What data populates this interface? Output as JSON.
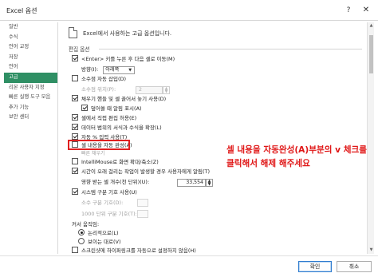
{
  "window": {
    "title": "Excel 옵션",
    "help_icon": "?",
    "close_icon": "✕"
  },
  "sidebar": {
    "items": [
      {
        "label": "일반",
        "active": false
      },
      {
        "label": "수식",
        "active": false
      },
      {
        "label": "언어 교정",
        "active": false
      },
      {
        "label": "저장",
        "active": false
      },
      {
        "label": "언어",
        "active": false
      },
      {
        "label": "고급",
        "active": true
      },
      {
        "label": "리본 사용자 지정",
        "active": false
      },
      {
        "label": "빠른 실행 도구 모음",
        "active": false
      },
      {
        "label": "추가 기능",
        "active": false
      },
      {
        "label": "보안 센터",
        "active": false
      }
    ]
  },
  "main": {
    "header_text": "Excel에서 사용하는 고급 옵션입니다.",
    "section_title": "편집 옵션",
    "options": {
      "enter_move": "<Enter> 키를 누른 후 다음 셀로 이동(M)",
      "direction_label": "방향(I):",
      "direction_value": "아래쪽",
      "auto_decimal": "소수점 자동 삽입(D)",
      "decimal_places_label": "소수점 위치(P):",
      "decimal_places_value": "2",
      "fill_handle": "채우기 핸들 및 셀 끌어서 놓기 사용(D)",
      "overwrite_alert": "덮어쓸 때 알림 표시(A)",
      "direct_edit": "셀에서 직접 편집 허용(E)",
      "extend_formats": "데이터 범위의 서식과 수식을 확장(L)",
      "auto_percent": "자동 % 입력 사용(T)",
      "autocomplete": "셀 내용을 자동 완성(A)",
      "flash_fill": "빠른 채우기",
      "intellimouse": "IntelliMouse로 화면 확대/축소(Z)",
      "slow_alert": "시간이 오래 걸리는 작업이 발생할 경우 사용자에게 알림(T)",
      "cells_affected_label": "영향 받는 셀 개수(천 단위)(U):",
      "cells_affected_value": "33,554",
      "system_separators": "시스템 구분 기호 사용(U)",
      "decimal_sep_label": "소수 구분 기호(D):",
      "thousands_sep_label": "1000 단위 구분 기호(T):",
      "cursor_move_label": "커서 움직임:",
      "cursor_logical": "논리적으로(L)",
      "cursor_visual": "보이는 대로(V)",
      "no_hyperlink_screenshot": "스크린샷에 하이퍼링크를 자동으로 설정하지 않음(H)"
    },
    "states": {
      "enter_move": true,
      "auto_decimal": false,
      "fill_handle": true,
      "overwrite_alert": true,
      "direct_edit": true,
      "extend_formats": true,
      "auto_percent": true,
      "autocomplete": false,
      "intellimouse": false,
      "slow_alert": true,
      "system_separators": true,
      "cursor": "logical",
      "no_hyperlink_screenshot": false
    }
  },
  "annotation": {
    "line1": "셀 내용을 자동완성(A)부분의 v 체크를",
    "line2": "클릭해서 해제 해주세요",
    "color": "#e01818"
  },
  "footer": {
    "ok_label": "확인",
    "cancel_label": "취소"
  },
  "colors": {
    "sidebar_active": "#2f8f64",
    "accent": "#2f7ccf"
  }
}
